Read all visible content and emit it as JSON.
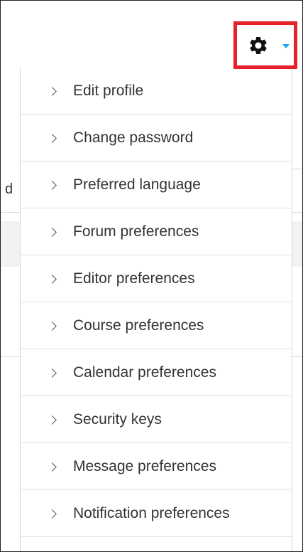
{
  "background": {
    "field_fragment": "d"
  },
  "toolbar": {
    "gear_icon": "gear-icon",
    "caret_icon": "caret-down-icon",
    "caret_color": "#1aa3e8",
    "highlight_color": "#e8202a"
  },
  "menu": {
    "items": [
      {
        "label": "Edit profile"
      },
      {
        "label": "Change password"
      },
      {
        "label": "Preferred language"
      },
      {
        "label": "Forum preferences"
      },
      {
        "label": "Editor preferences"
      },
      {
        "label": "Course preferences"
      },
      {
        "label": "Calendar preferences"
      },
      {
        "label": "Security keys"
      },
      {
        "label": "Message preferences"
      },
      {
        "label": "Notification preferences"
      }
    ]
  }
}
